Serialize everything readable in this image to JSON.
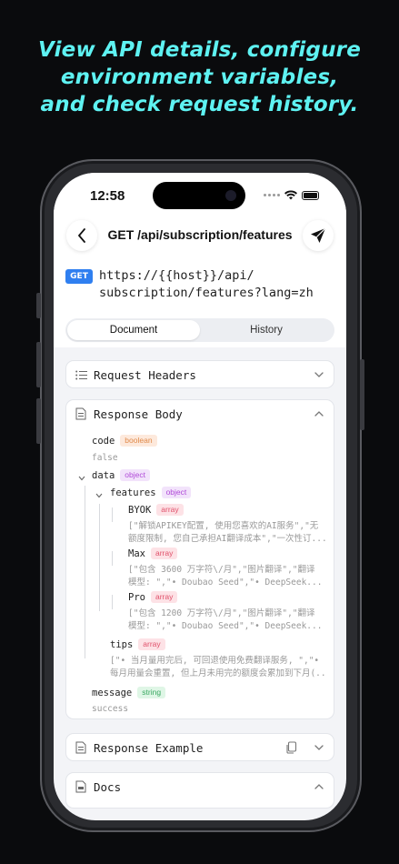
{
  "promo": {
    "line1": "View API details, configure",
    "line2": "environment variables,",
    "line3": "and check request history."
  },
  "status_bar": {
    "time": "12:58"
  },
  "header": {
    "title": "GET /api/subscription/features",
    "back_icon": "chevron-left-icon",
    "send_icon": "paper-plane-icon"
  },
  "request": {
    "method": "GET",
    "url_line1": "https://{{host}}/api/",
    "url_line2": "subscription/features?lang=zh"
  },
  "tabs": [
    {
      "label": "Document",
      "active": true
    },
    {
      "label": "History",
      "active": false
    }
  ],
  "sections": {
    "request_headers": "Request Headers",
    "response_body": "Response Body",
    "response_example": "Response Example",
    "docs": "Docs"
  },
  "response_body": {
    "code": {
      "key": "code",
      "type": "boolean",
      "value": "false"
    },
    "data": {
      "key": "data",
      "type": "object"
    },
    "features": {
      "key": "features",
      "type": "object"
    },
    "byok": {
      "key": "BYOK",
      "type": "array",
      "line1": "[\"解锁APIKEY配置, 使用您喜欢的AI服务\",\"无",
      "line2": "额度限制, 您自己承担AI翻译成本\",\"一次性订..."
    },
    "max": {
      "key": "Max",
      "type": "array",
      "line1": "[\"包含 3600 万字符\\/月\",\"图片翻译\",\"翻译",
      "line2": "模型: \",\"• Doubao Seed\",\"• DeepSeek..."
    },
    "pro": {
      "key": "Pro",
      "type": "array",
      "line1": "[\"包含 1200 万字符\\/月\",\"图片翻译\",\"翻译",
      "line2": "模型: \",\"• Doubao Seed\",\"• DeepSeek..."
    },
    "tips": {
      "key": "tips",
      "type": "array",
      "line1": "[\"• 当月量用完后, 可回退使用免费翻译服务, \",\"•",
      "line2": "每月用量会重置, 但上月未用完的额度会累加到下月(..."
    },
    "message": {
      "key": "message",
      "type": "string",
      "value": "success"
    }
  },
  "colors": {
    "promo_text": "#5ef2f2",
    "get_badge": "#2f7ff0",
    "tag_boolean": "#e08a4a",
    "tag_object": "#b04ad8",
    "tag_array": "#e0506a",
    "tag_string": "#3aa862"
  }
}
